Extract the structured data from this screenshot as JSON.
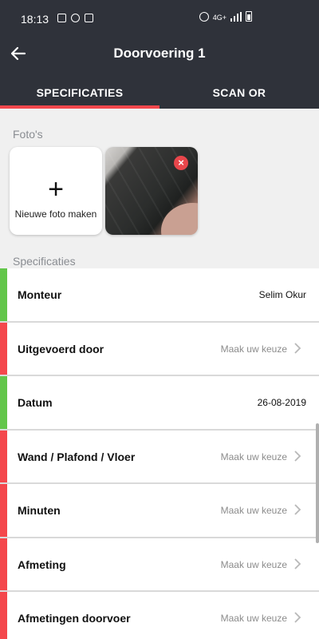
{
  "status_bar": {
    "time": "18:13",
    "network": "4G+"
  },
  "header": {
    "title": "Doorvoering 1"
  },
  "tabs": [
    {
      "label": "SPECIFICATIES",
      "active": true
    },
    {
      "label": "SCAN OR",
      "active": false
    }
  ],
  "photos": {
    "section_label": "Foto's",
    "add_label": "Nieuwe foto maken",
    "remove_symbol": "×"
  },
  "specs": {
    "section_label": "Specificaties",
    "rows": [
      {
        "label": "Monteur",
        "value": "Selim Okur",
        "status": "green"
      },
      {
        "label": "Uitgevoerd door",
        "value": "Maak uw keuze",
        "status": "red"
      },
      {
        "label": "Datum",
        "value": "26-08-2019",
        "status": "green"
      },
      {
        "label": "Wand / Plafond / Vloer",
        "value": "Maak uw keuze",
        "status": "red"
      },
      {
        "label": "Minuten",
        "value": "Maak uw keuze",
        "status": "red"
      },
      {
        "label": "Afmeting",
        "value": "Maak uw keuze",
        "status": "red"
      },
      {
        "label": "Afmetingen doorvoer",
        "value": "Maak uw keuze",
        "status": "red"
      }
    ]
  },
  "colors": {
    "header": "#2f323a",
    "accent": "#f4474c",
    "status_green": "#62c64a",
    "status_red": "#f4474c"
  }
}
